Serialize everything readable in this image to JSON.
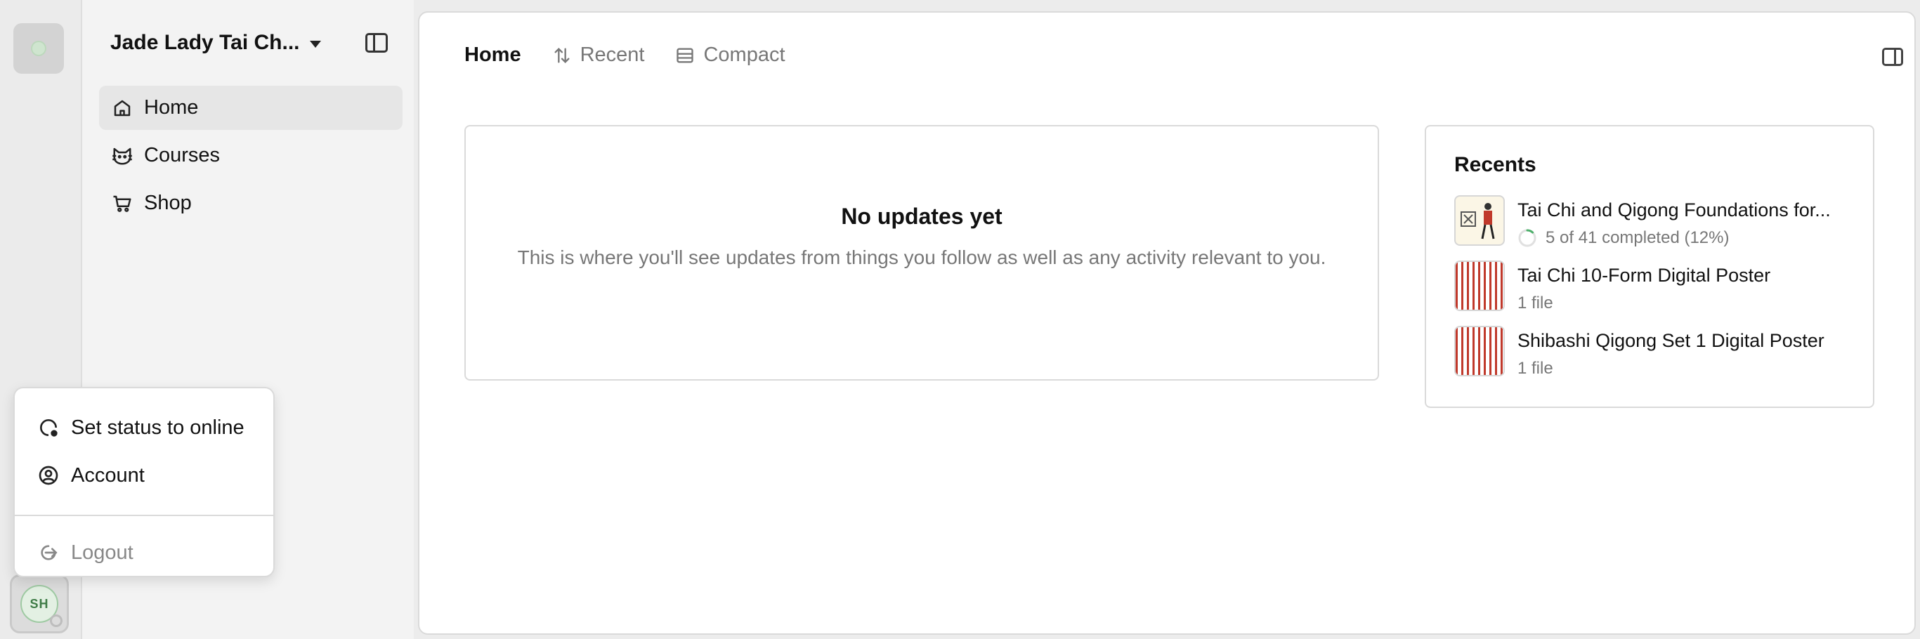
{
  "sidebar": {
    "space_name": "Jade Lady Tai Ch...",
    "items": [
      {
        "label": "Home",
        "icon": "home-icon",
        "active": true
      },
      {
        "label": "Courses",
        "icon": "courses-icon",
        "active": false
      },
      {
        "label": "Shop",
        "icon": "cart-icon",
        "active": false
      }
    ]
  },
  "user": {
    "initials": "SH"
  },
  "main": {
    "tabs": [
      {
        "label": "Home",
        "active": true
      },
      {
        "label": "Recent",
        "icon": "sort-arrows-icon"
      },
      {
        "label": "Compact",
        "icon": "list-layout-icon"
      }
    ],
    "updates": {
      "title": "No updates yet",
      "message": "This is where you'll see updates from things you follow as well as any activity relevant to you."
    },
    "recents": {
      "title": "Recents",
      "items": [
        {
          "title": "Tai Chi and Qigong Foundations for...",
          "subtitle": "5 of 41 completed (12%)",
          "progress": 0.12,
          "kind": "course"
        },
        {
          "title": "Tai Chi 10-Form Digital Poster",
          "subtitle": "1 file",
          "kind": "poster"
        },
        {
          "title": "Shibashi Qigong Set 1 Digital Poster",
          "subtitle": "1 file",
          "kind": "poster"
        }
      ]
    }
  },
  "popover": {
    "items": [
      {
        "label": "Set status to online",
        "icon": "status-icon"
      },
      {
        "label": "Account",
        "icon": "account-icon"
      },
      {
        "label": "Logout",
        "icon": "logout-icon"
      }
    ]
  },
  "colors": {
    "accent": "#3d7a45",
    "progress": "#4caf6a",
    "muted": "#777777"
  }
}
